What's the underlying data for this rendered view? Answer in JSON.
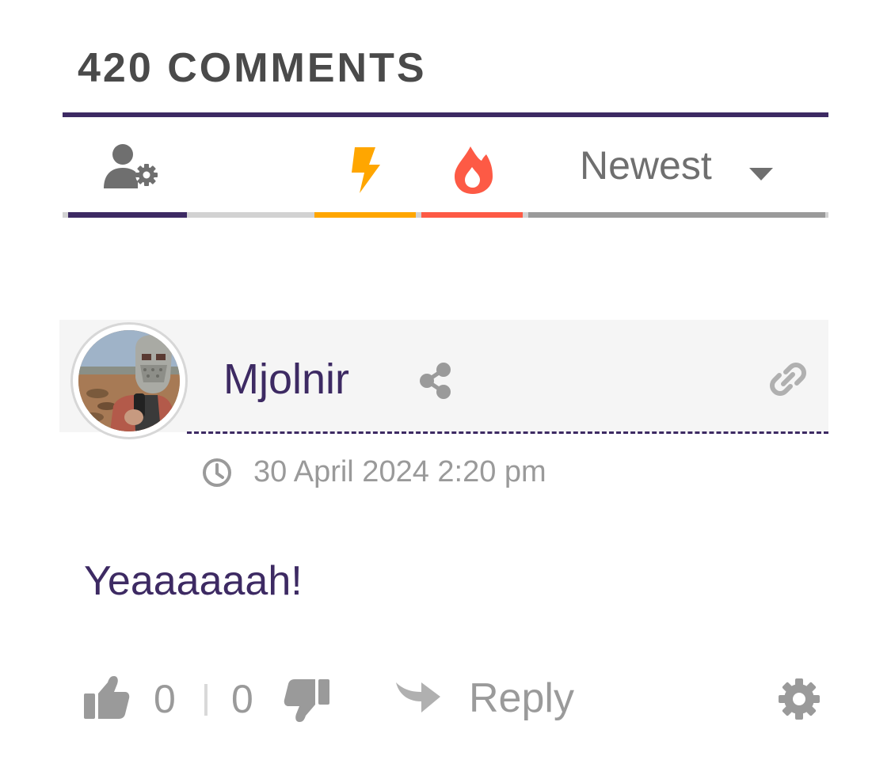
{
  "header": {
    "comments_title": "420 COMMENTS"
  },
  "filters": {
    "sort_selected": "Newest",
    "colors": {
      "accent": "#3d2a63",
      "bolt": "#ffa600",
      "hot": "#fd5a45",
      "muted": "#9a9a9a"
    }
  },
  "comment": {
    "author": "Mjolnir",
    "date": "30 April 2024 2:20 pm",
    "text": "Yeaaaaaah!",
    "likes": "0",
    "dislikes": "0",
    "reply_label": "Reply"
  }
}
